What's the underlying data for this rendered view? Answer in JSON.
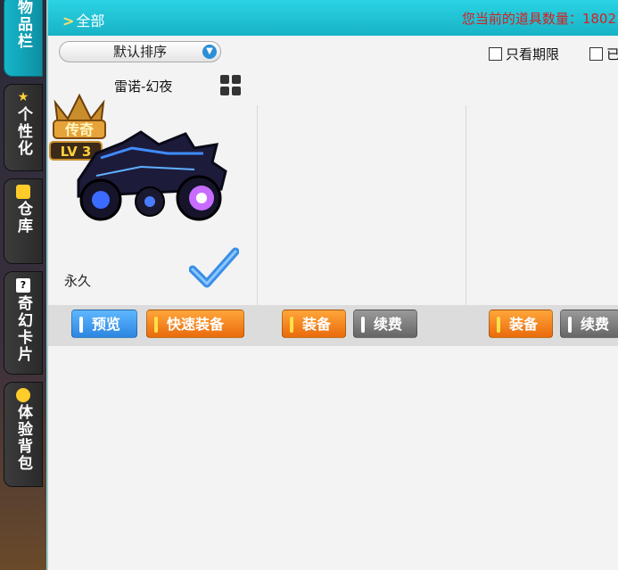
{
  "sidebar": {
    "tabs": [
      {
        "label": "物品栏",
        "active": true
      },
      {
        "label": "个性化",
        "active": false
      },
      {
        "label": "仓库",
        "active": false
      },
      {
        "label": "奇幻卡片",
        "active": false
      },
      {
        "label": "体验背包",
        "active": false
      }
    ]
  },
  "header": {
    "breadcrumb": "全部",
    "item_count_text": "您当前的道具数量：1802"
  },
  "toolbar": {
    "sort_value": "默认排序",
    "filter1_label": "只看期限",
    "filter2_label": "已"
  },
  "items": [
    {
      "name": "雷诺-幻夜",
      "badge_text": "传奇",
      "badge_level": "LV 3",
      "duration": "永久",
      "preview_label": "预览",
      "quick_equip_label": "快速装备"
    }
  ],
  "columns": [
    {
      "equip_label": "装备",
      "renew_label": "续费"
    },
    {
      "equip_label": "装备",
      "renew_label": "续费"
    }
  ],
  "colors": {
    "accent": "#18b2c6",
    "count_text": "#d61f1f",
    "equip": "#ea6a0c",
    "preview": "#2c86e0"
  }
}
